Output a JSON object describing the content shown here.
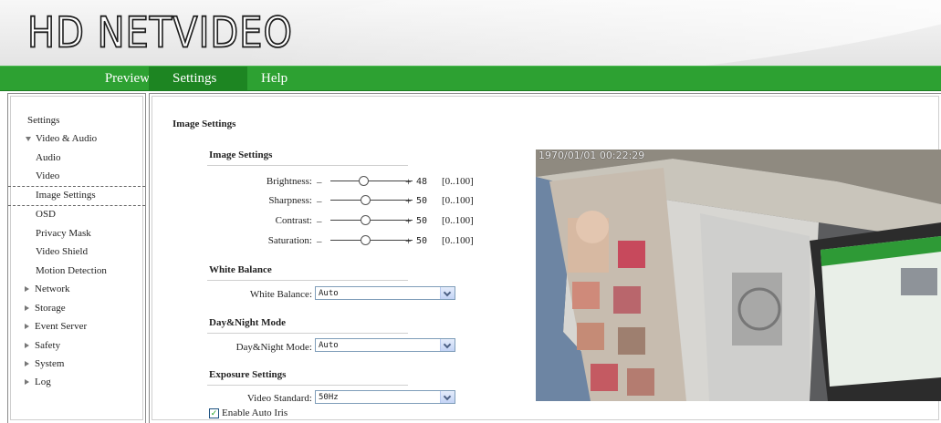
{
  "header": {
    "logo": "HD NETVIDEO"
  },
  "nav": {
    "preview": "Preview",
    "settings": "Settings",
    "help": "Help"
  },
  "sidebar": {
    "items": [
      {
        "label": "Settings"
      },
      {
        "label": "Video & Audio"
      },
      {
        "label": "Audio"
      },
      {
        "label": "Video"
      },
      {
        "label": "Image Settings",
        "selected": true
      },
      {
        "label": "OSD"
      },
      {
        "label": "Privacy Mask"
      },
      {
        "label": "Video Shield"
      },
      {
        "label": "Motion Detection"
      },
      {
        "label": "Network"
      },
      {
        "label": "Storage"
      },
      {
        "label": "Event Server"
      },
      {
        "label": "Safety"
      },
      {
        "label": "System"
      },
      {
        "label": "Log"
      }
    ]
  },
  "page": {
    "title": "Image Settings",
    "image_settings": {
      "title": "Image Settings",
      "brightness": {
        "label": "Brightness:",
        "value": "48",
        "range": "[0..100]",
        "minus": "_",
        "plus": "+"
      },
      "sharpness": {
        "label": "Sharpness:",
        "value": "50",
        "range": "[0..100]",
        "minus": "_",
        "plus": "+"
      },
      "contrast": {
        "label": "Contrast:",
        "value": "50",
        "range": "[0..100]",
        "minus": "_",
        "plus": "+"
      },
      "saturation": {
        "label": "Saturation:",
        "value": "50",
        "range": "[0..100]",
        "minus": "_",
        "plus": "+"
      }
    },
    "white_balance": {
      "title": "White Balance",
      "label": "White Balance:",
      "value": "Auto"
    },
    "day_night": {
      "title": "Day&Night Mode",
      "label": "Day&Night Mode:",
      "value": "Auto"
    },
    "exposure": {
      "title": "Exposure Settings",
      "label": "Video Standard:",
      "value": "50Hz",
      "auto_iris": "Enable Auto Iris",
      "auto_iris_checked": true
    }
  },
  "video": {
    "timestamp": "1970/01/01 00:22:29"
  },
  "colors": {
    "nav_green": "#2da132",
    "nav_active": "#1d8522"
  }
}
